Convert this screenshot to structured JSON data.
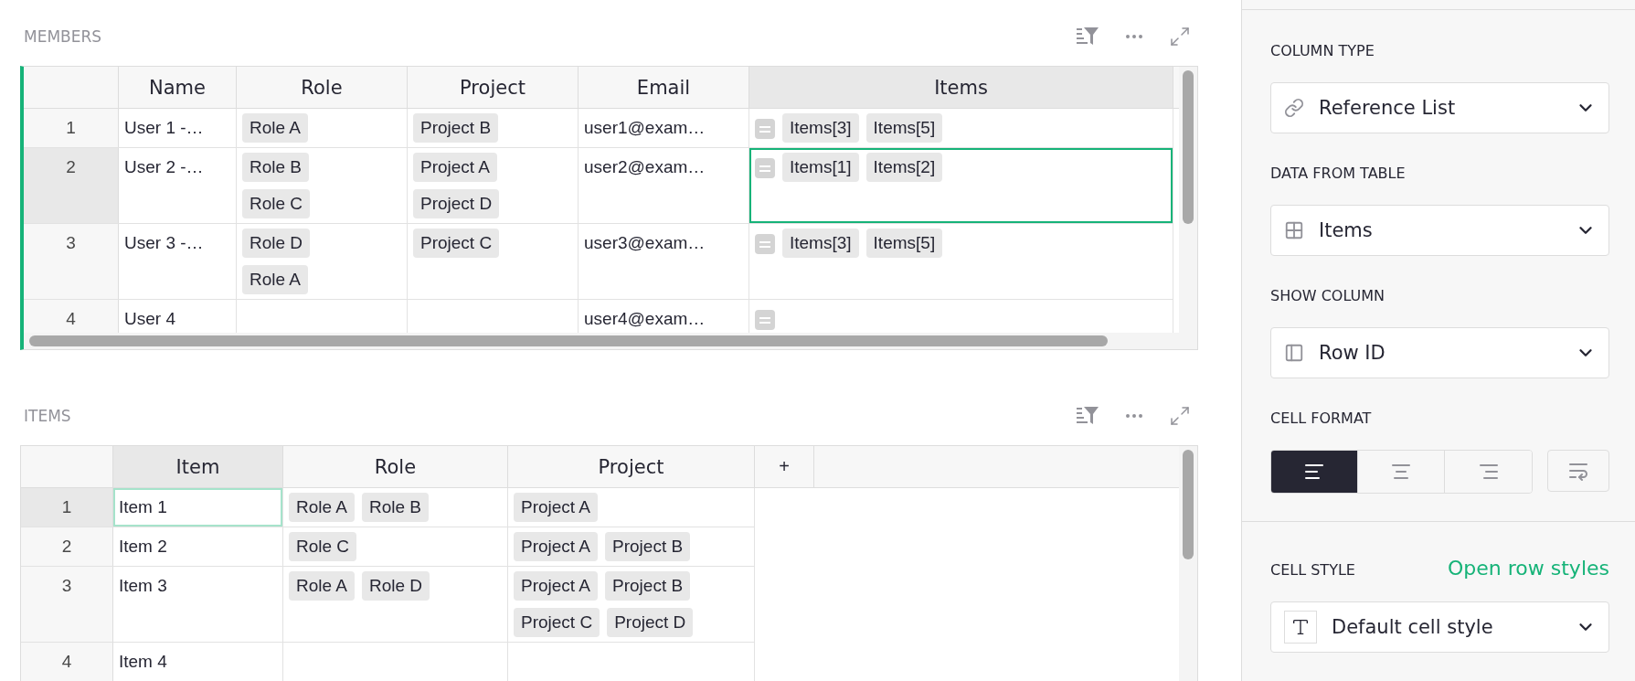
{
  "members": {
    "title": "MEMBERS",
    "active": true,
    "columns": [
      {
        "label": "Name",
        "selected": false
      },
      {
        "label": "Role",
        "selected": false
      },
      {
        "label": "Project",
        "selected": false
      },
      {
        "label": "Email",
        "selected": false
      },
      {
        "label": "Items",
        "selected": true
      }
    ],
    "rows": [
      {
        "number": "1",
        "selected": false,
        "cells": [
          {
            "kind": "text",
            "text": "User 1 -…",
            "cursor": false
          },
          {
            "kind": "chips",
            "chips": [
              "Role A"
            ],
            "cursor": false
          },
          {
            "kind": "chips",
            "chips": [
              "Project B"
            ],
            "cursor": false
          },
          {
            "kind": "text",
            "text": "user1@exam…",
            "cursor": false
          },
          {
            "kind": "reflist",
            "chips": [
              "Items[3]",
              "Items[5]"
            ],
            "cursor": false
          }
        ]
      },
      {
        "number": "2",
        "selected": true,
        "cells": [
          {
            "kind": "text",
            "text": "User 2 -…",
            "cursor": false
          },
          {
            "kind": "chips",
            "chips": [
              "Role B",
              "Role C"
            ],
            "cursor": false
          },
          {
            "kind": "chips",
            "chips": [
              "Project A",
              "Project D"
            ],
            "cursor": false
          },
          {
            "kind": "text",
            "text": "user2@exam…",
            "cursor": false
          },
          {
            "kind": "reflist",
            "chips": [
              "Items[1]",
              "Items[2]"
            ],
            "cursor": true
          }
        ]
      },
      {
        "number": "3",
        "selected": false,
        "cells": [
          {
            "kind": "text",
            "text": "User 3 -…",
            "cursor": false
          },
          {
            "kind": "chips",
            "chips": [
              "Role D",
              "Role A"
            ],
            "cursor": false
          },
          {
            "kind": "chips",
            "chips": [
              "Project C"
            ],
            "cursor": false
          },
          {
            "kind": "text",
            "text": "user3@exam…",
            "cursor": false
          },
          {
            "kind": "reflist",
            "chips": [
              "Items[3]",
              "Items[5]"
            ],
            "cursor": false
          }
        ]
      },
      {
        "number": "4",
        "selected": false,
        "cells": [
          {
            "kind": "text",
            "text": "User 4",
            "cursor": false
          },
          {
            "kind": "empty",
            "cursor": false
          },
          {
            "kind": "empty",
            "cursor": false
          },
          {
            "kind": "text",
            "text": "user4@exam…",
            "cursor": false
          },
          {
            "kind": "reflist",
            "cursor": false
          }
        ]
      }
    ]
  },
  "items": {
    "title": "ITEMS",
    "active": false,
    "add_column": "+",
    "columns": [
      {
        "label": "Item",
        "selected": true
      },
      {
        "label": "Role",
        "selected": false
      },
      {
        "label": "Project",
        "selected": false
      }
    ],
    "rows": [
      {
        "number": "1",
        "selected": true,
        "cells": [
          {
            "kind": "text",
            "text": "Item 1",
            "cursor": true
          },
          {
            "kind": "chips",
            "chips": [
              "Role A",
              "Role B"
            ],
            "cursor": false
          },
          {
            "kind": "chips",
            "chips": [
              "Project A"
            ],
            "cursor": false
          }
        ]
      },
      {
        "number": "2",
        "selected": false,
        "cells": [
          {
            "kind": "text",
            "text": "Item 2",
            "cursor": false
          },
          {
            "kind": "chips",
            "chips": [
              "Role C"
            ],
            "cursor": false
          },
          {
            "kind": "chips",
            "chips": [
              "Project A",
              "Project B"
            ],
            "cursor": false
          }
        ]
      },
      {
        "number": "3",
        "selected": false,
        "cells": [
          {
            "kind": "text",
            "text": "Item 3",
            "cursor": false
          },
          {
            "kind": "chips",
            "chips": [
              "Role A",
              "Role D"
            ],
            "cursor": false
          },
          {
            "kind": "chips",
            "chips": [
              "Project A",
              "Project B",
              "Project C",
              "Project D"
            ],
            "cursor": false
          }
        ]
      },
      {
        "number": "4",
        "selected": false,
        "cells": [
          {
            "kind": "text",
            "text": "Item 4",
            "cursor": false
          },
          {
            "kind": "empty",
            "cursor": false
          },
          {
            "kind": "empty",
            "cursor": false
          }
        ]
      }
    ]
  },
  "panel": {
    "column_type": {
      "label": "COLUMN TYPE",
      "value": "Reference List"
    },
    "data_from_table": {
      "label": "DATA FROM TABLE",
      "value": "Items"
    },
    "show_column": {
      "label": "SHOW COLUMN",
      "value": "Row ID"
    },
    "cell_format": {
      "label": "CELL FORMAT",
      "options": [
        {
          "kind": "left",
          "selected": true
        },
        {
          "kind": "center",
          "selected": false
        },
        {
          "kind": "right",
          "selected": false
        }
      ],
      "wrap": {
        "selected": false
      }
    },
    "cell_style": {
      "label": "CELL STYLE",
      "link": "Open row styles",
      "value": "Default cell style"
    }
  }
}
